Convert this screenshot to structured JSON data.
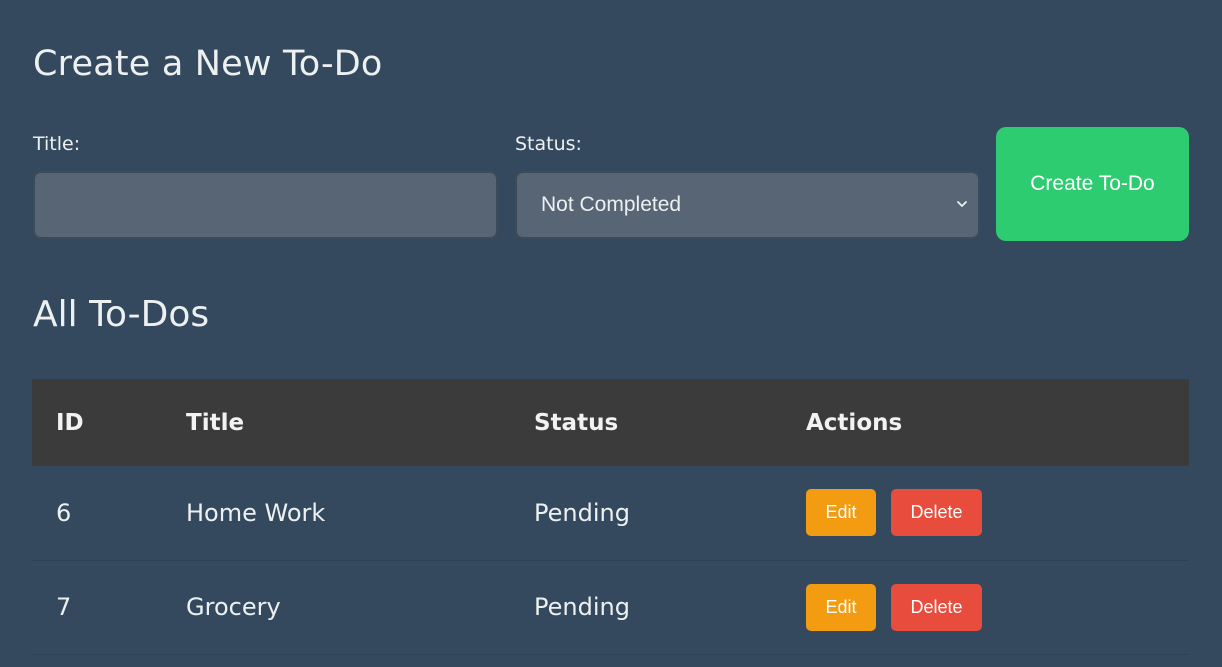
{
  "create_section": {
    "heading": "Create a New To-Do",
    "title_label": "Title:",
    "title_value": "",
    "status_label": "Status:",
    "status_selected": "Not Completed",
    "create_button": "Create To-Do"
  },
  "list_section": {
    "heading": "All To-Dos",
    "columns": [
      "ID",
      "Title",
      "Status",
      "Actions"
    ],
    "rows": [
      {
        "id": "6",
        "title": "Home Work",
        "status": "Pending",
        "edit": "Edit",
        "delete": "Delete"
      },
      {
        "id": "7",
        "title": "Grocery",
        "status": "Pending",
        "edit": "Edit",
        "delete": "Delete"
      }
    ]
  },
  "icons": {
    "status_select": "chevron-down-icon"
  },
  "colors": {
    "background": "#34495e",
    "input_bg": "#576574",
    "create_button": "#2ecc71",
    "table_header": "#3b3b3b",
    "edit_button": "#f39c12",
    "delete_button": "#e74c3c"
  }
}
